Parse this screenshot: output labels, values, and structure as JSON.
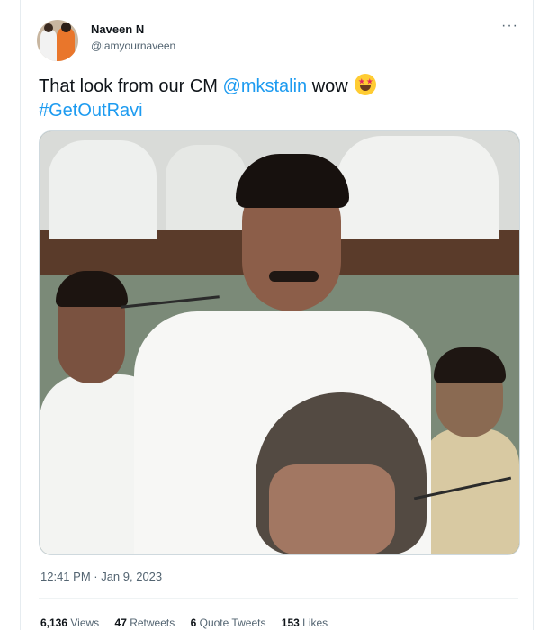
{
  "tweet": {
    "author_name": "Naveen N",
    "author_handle": "@iamyournaveen",
    "more_label": "···",
    "text_prefix": "That look from our CM ",
    "mention": "@mkstalin",
    "text_suffix": " wow",
    "emoji": "star-struck-emoji",
    "hashtag": "#GetOutRavi",
    "timestamp": "12:41 PM · Jan 9, 2023"
  },
  "stats": {
    "views_count": "6,136",
    "views_label": "Views",
    "retweets_count": "47",
    "retweets_label": "Retweets",
    "quotes_count": "6",
    "quotes_label": "Quote Tweets",
    "likes_count": "153",
    "likes_label": "Likes"
  },
  "colors": {
    "link": "#1d9bf0",
    "text": "#0f1419",
    "secondary": "#536471"
  }
}
